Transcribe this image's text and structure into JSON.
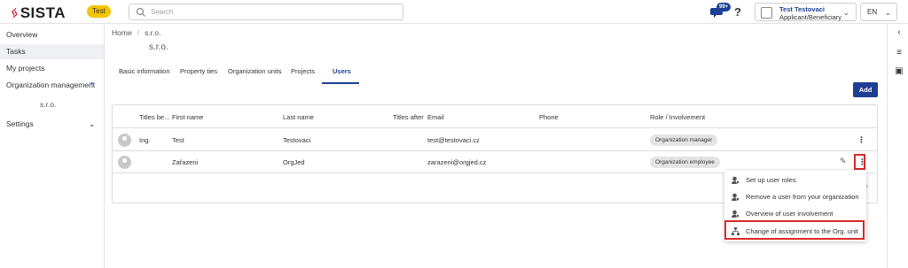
{
  "header": {
    "logo_text": "SISTA",
    "env_badge": "Test",
    "search_placeholder": "Search",
    "notifications_count": "99+",
    "help_label": "?",
    "user_name": "Test Testovaci",
    "user_role": "Applicant/Beneficiary",
    "language": "EN"
  },
  "sidebar": {
    "items": [
      {
        "label": "Overview"
      },
      {
        "label": "Tasks"
      },
      {
        "label": "My projects"
      },
      {
        "label": "Organization management"
      },
      {
        "label": "s.r.o."
      },
      {
        "label": "Settings"
      }
    ]
  },
  "breadcrumb": {
    "home": "Home",
    "sep": "/",
    "current": "s.r.o."
  },
  "page": {
    "title": "s.r.o."
  },
  "tabs": [
    {
      "label": "Basic information"
    },
    {
      "label": "Property ties"
    },
    {
      "label": "Organization units"
    },
    {
      "label": "Projects"
    },
    {
      "label": "Users"
    }
  ],
  "actions": {
    "add_label": "Add"
  },
  "table": {
    "columns": [
      "Titles be...",
      "First name",
      "Last name",
      "Titles after",
      "Email",
      "Phone",
      "Role / Involvement"
    ],
    "rows": [
      {
        "title_before": "Ing.",
        "first_name": "Test",
        "last_name": "Testovaci",
        "title_after": "",
        "email": "test@testovaci.cz",
        "phone": "",
        "role": "Organization manager"
      },
      {
        "title_before": "",
        "first_name": "Zařazeni",
        "last_name": "OrgJed",
        "title_after": "",
        "email": "zarazeni@orgjed.cz",
        "phone": "",
        "role": "Organization employee"
      }
    ]
  },
  "context_menu": {
    "items": [
      {
        "label": "Set up user roles"
      },
      {
        "label": "Remove a user from your organization"
      },
      {
        "label": "Overview of user involvement"
      },
      {
        "label": "Change of assignment to the Org. unit"
      }
    ]
  },
  "colors": {
    "primary": "#1d3f93",
    "highlight": "#d62b2b",
    "badge": "#f5c400"
  }
}
